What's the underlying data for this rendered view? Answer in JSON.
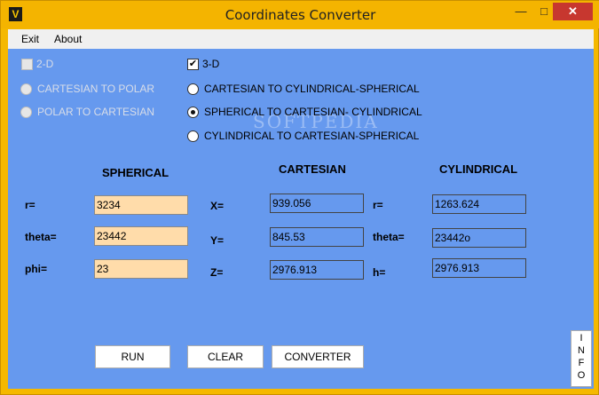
{
  "window": {
    "title": "Coordinates Converter",
    "icon_letter": "V",
    "min_symbol": "—",
    "max_symbol": "□",
    "close_symbol": "✕"
  },
  "menu": {
    "exit": "Exit",
    "about": "About"
  },
  "mode": {
    "two_d_label": "2-D",
    "two_d_checked": false,
    "three_d_label": "3-D",
    "three_d_checked": true
  },
  "two_d_options": [
    {
      "label": "CARTESIAN TO POLAR",
      "checked": false
    },
    {
      "label": "POLAR TO CARTESIAN",
      "checked": false
    }
  ],
  "three_d_options": [
    {
      "label": "CARTESIAN TO CYLINDRICAL-SPHERICAL",
      "checked": false
    },
    {
      "label": "SPHERICAL TO CARTESIAN- CYLINDRICAL",
      "checked": true
    },
    {
      "label": "CYLINDRICAL TO CARTESIAN-SPHERICAL",
      "checked": false
    }
  ],
  "watermark": "SOFTPEDIA",
  "spherical": {
    "heading": "SPHERICAL",
    "r_label": "r=",
    "r_value": "3234",
    "theta_label": "theta=",
    "theta_value": "23442",
    "phi_label": "phi=",
    "phi_value": "23"
  },
  "cartesian": {
    "heading": "CARTESIAN",
    "x_label": "X=",
    "x_value": "939.056",
    "y_label": "Y=",
    "y_value": "845.53",
    "z_label": "Z=",
    "z_value": "2976.913"
  },
  "cylindrical": {
    "heading": "CYLINDRICAL",
    "r_label": "r=",
    "r_value": "1263.624",
    "theta_label": "theta=",
    "theta_value": "23442o",
    "h_label": "h=",
    "h_value": "2976.913"
  },
  "buttons": {
    "run": "RUN",
    "clear": "CLEAR",
    "converter": "CONVERTER",
    "info": [
      "I",
      "N",
      "F",
      "O"
    ]
  },
  "colors": {
    "client_bg": "#6699ee",
    "input_bg": "#ffdcaa",
    "titlebar": "#f4b400",
    "close": "#c7372f"
  }
}
